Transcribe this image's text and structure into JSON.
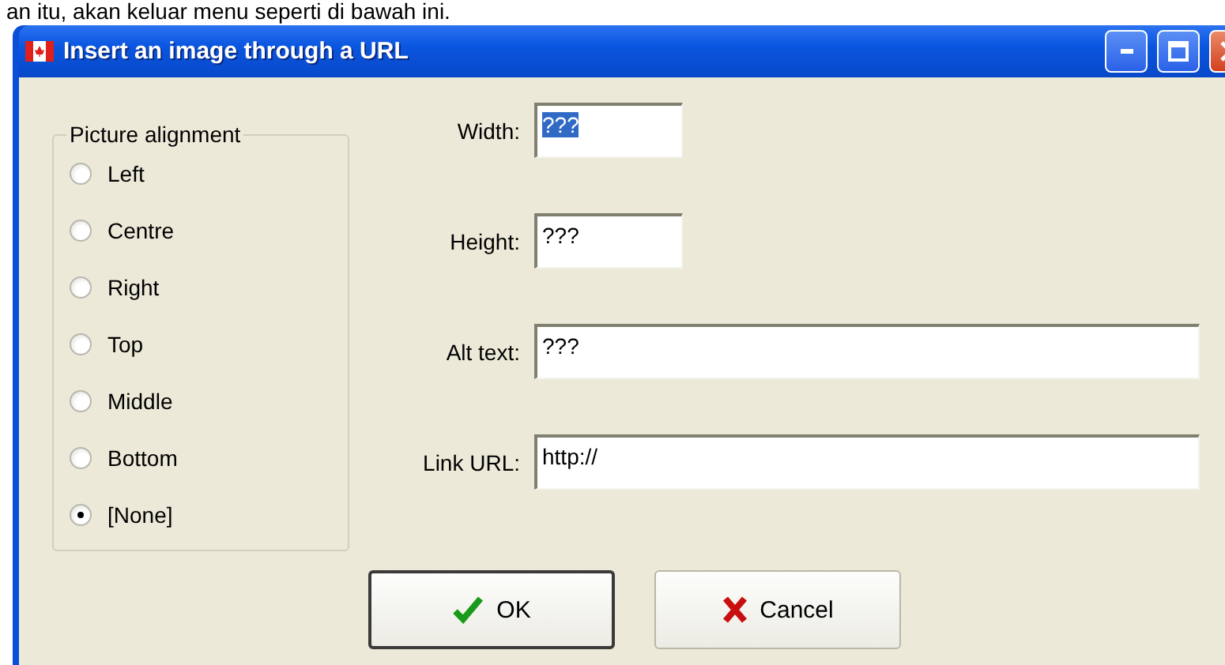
{
  "page_text": "an itu, akan keluar menu seperti di bawah ini.",
  "window": {
    "title": "Insert an image through a URL"
  },
  "alignment_group": {
    "title": "Picture alignment",
    "options": [
      {
        "label": "Left",
        "selected": false
      },
      {
        "label": "Centre",
        "selected": false
      },
      {
        "label": "Right",
        "selected": false
      },
      {
        "label": "Top",
        "selected": false
      },
      {
        "label": "Middle",
        "selected": false
      },
      {
        "label": "Bottom",
        "selected": false
      },
      {
        "label": "[None]",
        "selected": true
      }
    ]
  },
  "fields": [
    {
      "label": "Width:",
      "value": "???",
      "kind": "short",
      "text_selected": true
    },
    {
      "label": "Height:",
      "value": "???",
      "kind": "short",
      "text_selected": false
    },
    {
      "label": "Alt text:",
      "value": "???",
      "kind": "long",
      "text_selected": false
    },
    {
      "label": "Link URL:",
      "value": "http://",
      "kind": "long",
      "text_selected": false
    }
  ],
  "buttons": [
    {
      "label": "OK",
      "kind": "ok",
      "default": true
    },
    {
      "label": "Cancel",
      "kind": "cancel",
      "default": false
    }
  ]
}
